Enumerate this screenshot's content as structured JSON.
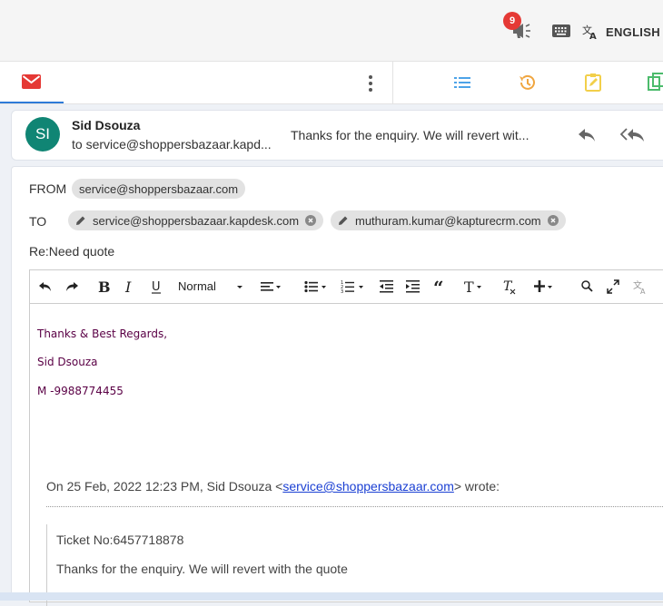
{
  "topbar": {
    "notification_count": "9",
    "language": "ENGLISH"
  },
  "email": {
    "avatar_initials": "SI",
    "sender": "Sid Dsouza",
    "to_line": "to service@shoppersbazaar.kapd...",
    "preview": "Thanks for the enquiry. We will revert wit..."
  },
  "compose": {
    "from_label": "FROM",
    "from_value": "service@shoppersbazaar.com",
    "to_label": "TO",
    "to_recipients": [
      "service@shoppersbazaar.kapdesk.com",
      "muthuram.kumar@kapturecrm.com"
    ],
    "subject": "Re:Need quote",
    "format_selected": "Normal",
    "signature": [
      "Thanks & Best Regards,",
      "Sid Dsouza",
      "M -9988774455"
    ],
    "quote_prefix": "On 25 Feb, 2022 12:23 PM, Sid Dsouza <",
    "quote_email": "service@shoppersbazaar.com",
    "quote_suffix": "> wrote:",
    "quoted_lines": [
      "Ticket No:6457718878",
      "Thanks for the enquiry. We will revert with the quote"
    ]
  },
  "colors": {
    "accent_blue": "#2e7bd8",
    "badge_red": "#e53935",
    "avatar_teal": "#108574",
    "signature_purple": "#5a0045"
  }
}
